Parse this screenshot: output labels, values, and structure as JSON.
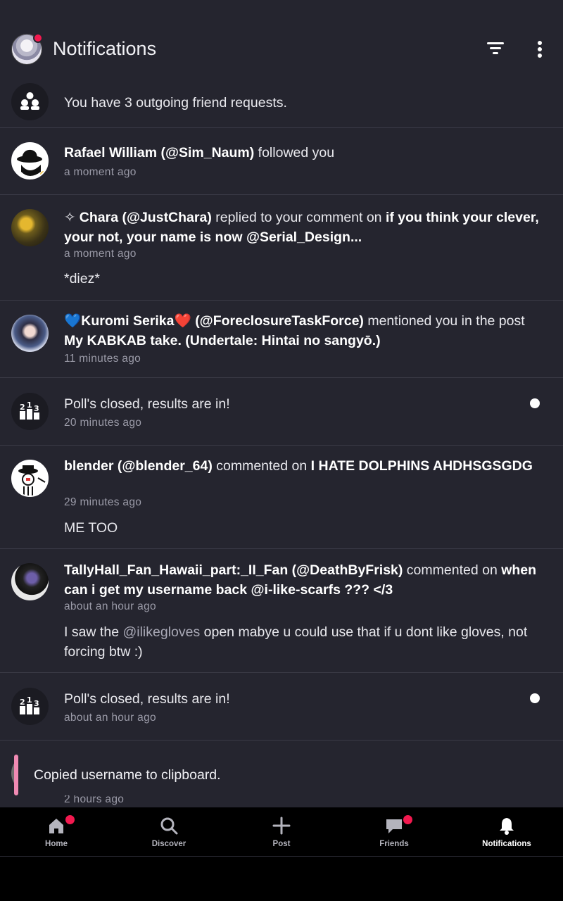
{
  "header": {
    "title": "Notifications"
  },
  "friend_requests": {
    "text": "You have 3 outgoing friend requests."
  },
  "notifications": [
    {
      "user": "Rafael William (@Sim_Naum)",
      "action": " followed you",
      "time": "a moment ago"
    },
    {
      "prefix": "✧ ",
      "user": "Chara (@JustChara)",
      "action": " replied to your comment on ",
      "target": "if you think your clever, your not, your name is now @Serial_Design...",
      "time": "a moment ago",
      "body": "*diez*"
    },
    {
      "user": "💙Kuromi Serika❤️ (@ForeclosureTaskForce)",
      "action": " mentioned you in the post ",
      "target": "My KABKAB take. (Undertale: Hintai no sangyō.)",
      "time": "11 minutes ago"
    },
    {
      "text": "Poll's closed, results are in!",
      "time": "20 minutes ago"
    },
    {
      "user": "blender (@blender_64)",
      "action": " commented on ",
      "target": "I HATE DOLPHINS AHDHSGSGDG",
      "time": "29 minutes ago",
      "body": "ME TOO"
    },
    {
      "user": "TallyHall_Fan_Hawaii_part:_II_Fan (@DeathByFrisk)",
      "action": " commented on ",
      "target": "when can i get my username back @i-like-scarfs ??? </3",
      "time": "about an hour ago",
      "body_pre": "I saw the ",
      "body_mention": "@ilikegloves",
      "body_post": " open mabye u could use that if u dont like gloves, not forcing btw :)"
    },
    {
      "text": "Poll's closed, results are in!",
      "time": "about an hour ago"
    },
    {
      "time": "2 hours ago"
    }
  ],
  "toast": {
    "text": "Copied username to clipboard."
  },
  "nav": {
    "home": "Home",
    "discover": "Discover",
    "post": "Post",
    "friends": "Friends",
    "notifications": "Notifications"
  },
  "colors": {
    "background": "#25252f",
    "accent_badge": "#f2194f",
    "toast_bar": "#f08ab3",
    "nav_background": "#000000"
  }
}
